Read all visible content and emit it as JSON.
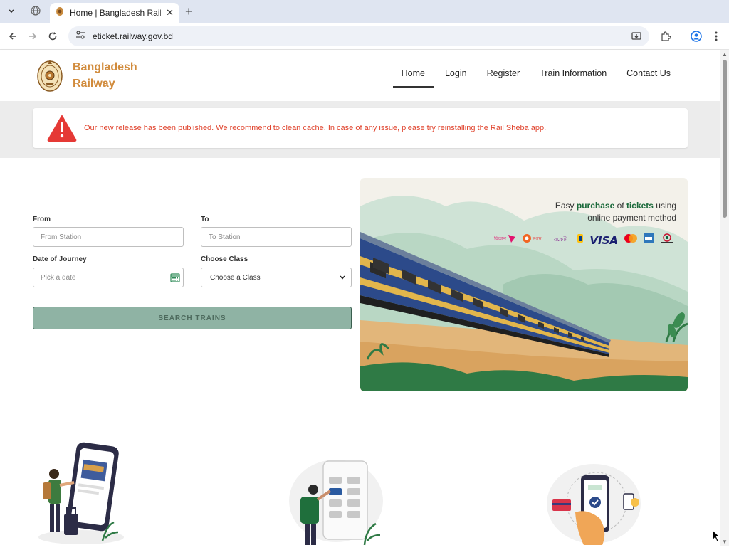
{
  "browser": {
    "tab_title": "Home | Bangladesh Railway",
    "url": "eticket.railway.gov.bd"
  },
  "brand": {
    "line1": "Bangladesh",
    "line2": "Railway"
  },
  "nav": {
    "items": [
      "Home",
      "Login",
      "Register",
      "Train Information",
      "Contact Us"
    ],
    "active": "Home"
  },
  "alert": {
    "message": "Our new release has been published. We recommend to clean cache. In case of any issue, please try reinstalling the Rail Sheba app."
  },
  "search_form": {
    "from_label": "From",
    "from_placeholder": "From Station",
    "to_label": "To",
    "to_placeholder": "To Station",
    "date_label": "Date of Journey",
    "date_placeholder": "Pick a date",
    "class_label": "Choose Class",
    "class_selected": "Choose a Class",
    "search_button": "SEARCH TRAINS"
  },
  "banner": {
    "line1_pre": "Easy ",
    "line1_bold1": "purchase",
    "line1_mid": " of ",
    "line1_bold2": "tickets",
    "line1_post": " using",
    "line2": "online payment method",
    "payment_logos": [
      "bKash",
      "Nagad",
      "Rocket",
      "Upay",
      "VISA",
      "Mastercard",
      "Amex",
      "Dutch-Bangla"
    ],
    "visa_text": "VISA"
  },
  "colors": {
    "brand": "#d18b3c",
    "alert_text": "#e0442e",
    "search_button_bg": "#8fb3a4",
    "banner_green": "#1b6a3b"
  }
}
